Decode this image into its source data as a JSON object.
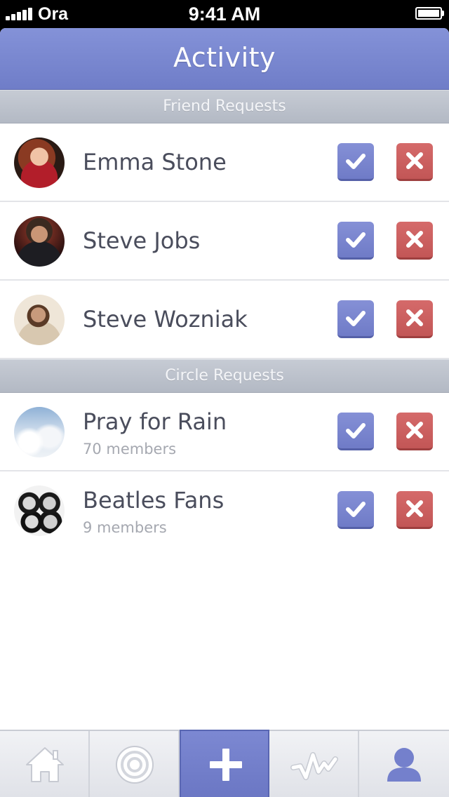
{
  "status_bar": {
    "carrier": "Ora",
    "time": "9:41 AM"
  },
  "header": {
    "title": "Activity"
  },
  "sections": [
    {
      "title": "Friend Requests",
      "items": [
        {
          "name": "Emma Stone"
        },
        {
          "name": "Steve Jobs"
        },
        {
          "name": "Steve Wozniak"
        }
      ]
    },
    {
      "title": "Circle Requests",
      "items": [
        {
          "name": "Pray for Rain",
          "subtitle": "70 members"
        },
        {
          "name": "Beatles Fans",
          "subtitle": "9 members"
        }
      ]
    }
  ],
  "tab_bar": {
    "tabs": [
      {
        "icon": "home-icon"
      },
      {
        "icon": "target-icon"
      },
      {
        "icon": "plus-icon",
        "active": true
      },
      {
        "icon": "activity-pulse-icon"
      },
      {
        "icon": "profile-icon"
      }
    ]
  },
  "colors": {
    "accent": "#7480cc",
    "accept": "#7a85d0",
    "decline": "#c96060",
    "text": "#4a4d5c",
    "subtext": "#a5a8b0"
  }
}
